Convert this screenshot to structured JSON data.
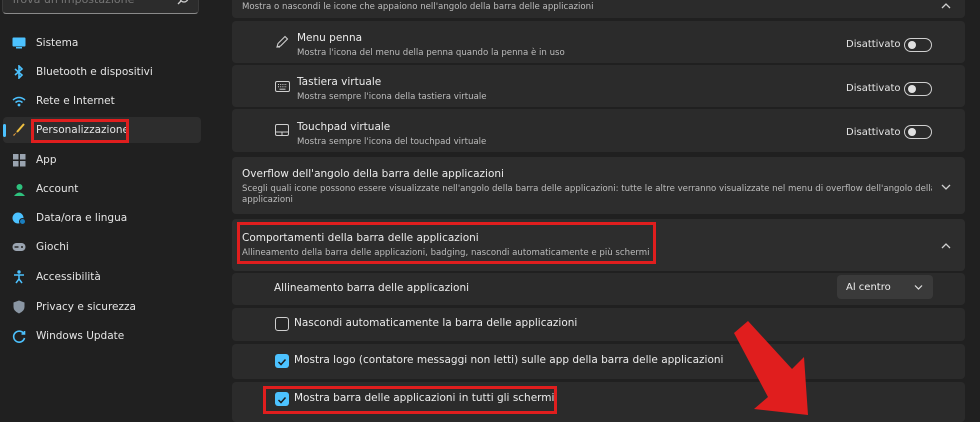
{
  "search": {
    "placeholder": "Trova un'impostazione"
  },
  "sidebar": {
    "items": [
      {
        "label": "Sistema",
        "icon": "monitor-icon"
      },
      {
        "label": "Bluetooth e dispositivi",
        "icon": "bluetooth-icon"
      },
      {
        "label": "Rete e Internet",
        "icon": "wifi-icon"
      },
      {
        "label": "Personalizzazione",
        "icon": "brush-icon",
        "active": true
      },
      {
        "label": "App",
        "icon": "apps-icon"
      },
      {
        "label": "Account",
        "icon": "account-icon"
      },
      {
        "label": "Data/ora e lingua",
        "icon": "globe-clock-icon"
      },
      {
        "label": "Giochi",
        "icon": "gamepad-icon"
      },
      {
        "label": "Accessibilità",
        "icon": "accessibility-icon"
      },
      {
        "label": "Privacy e sicurezza",
        "icon": "shield-icon"
      },
      {
        "label": "Windows Update",
        "icon": "update-icon"
      }
    ]
  },
  "top_card": {
    "subtitle": "Mostra o nascondi le icone che appaiono nell'angolo della barra delle applicazioni"
  },
  "corner_icons": [
    {
      "title": "Menu penna",
      "subtitle": "Mostra l'icona del menu della penna quando la penna è in uso",
      "state": "Disattivato",
      "icon": "pen-icon"
    },
    {
      "title": "Tastiera virtuale",
      "subtitle": "Mostra sempre l'icona della tastiera virtuale",
      "state": "Disattivato",
      "icon": "keyboard-icon"
    },
    {
      "title": "Touchpad virtuale",
      "subtitle": "Mostra sempre l'icona del touchpad virtuale",
      "state": "Disattivato",
      "icon": "touchpad-icon"
    }
  ],
  "overflow": {
    "title": "Overflow dell'angolo della barra delle applicazioni",
    "subtitle": "Scegli quali icone possono essere visualizzate nell'angolo della barra delle applicazioni: tutte le altre verranno visualizzate nel menu di overflow dell'angolo della barra delle",
    "subtitle2": "applicazioni"
  },
  "behaviors": {
    "title": "Comportamenti della barra delle applicazioni",
    "subtitle": "Allineamento della barra delle applicazioni, badging, nascondi automaticamente e più schermi",
    "alignment_label": "Allineamento barra delle applicazioni",
    "alignment_value": "Al centro",
    "options": [
      {
        "label": "Nascondi automaticamente la barra delle applicazioni",
        "checked": false
      },
      {
        "label": "Mostra logo (contatore messaggi non letti) sulle app della barra delle applicazioni",
        "checked": true
      },
      {
        "label": "Mostra barra delle applicazioni in tutti gli schermi",
        "checked": true
      }
    ]
  },
  "colors": {
    "accent": "#4cc2ff",
    "highlight": "#e01e1e"
  }
}
